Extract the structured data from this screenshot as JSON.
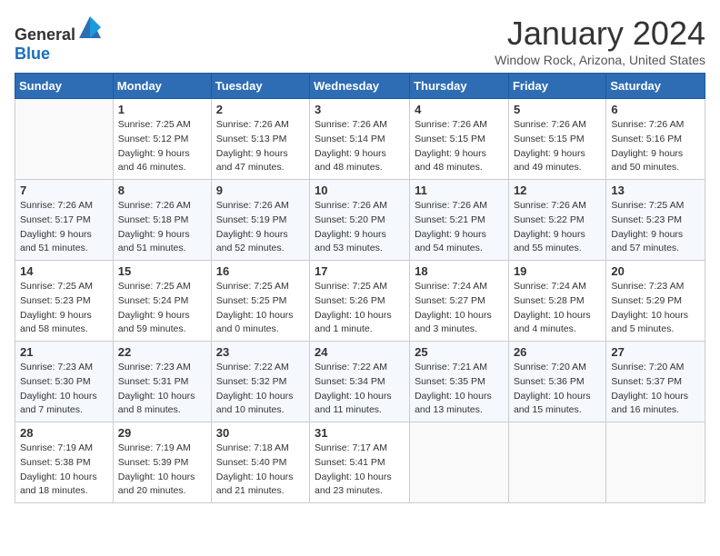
{
  "header": {
    "logo_general": "General",
    "logo_blue": "Blue",
    "month_title": "January 2024",
    "location": "Window Rock, Arizona, United States"
  },
  "days_of_week": [
    "Sunday",
    "Monday",
    "Tuesday",
    "Wednesday",
    "Thursday",
    "Friday",
    "Saturday"
  ],
  "weeks": [
    [
      {
        "day": "",
        "sunrise": "",
        "sunset": "",
        "daylight": ""
      },
      {
        "day": "1",
        "sunrise": "Sunrise: 7:25 AM",
        "sunset": "Sunset: 5:12 PM",
        "daylight": "Daylight: 9 hours and 46 minutes."
      },
      {
        "day": "2",
        "sunrise": "Sunrise: 7:26 AM",
        "sunset": "Sunset: 5:13 PM",
        "daylight": "Daylight: 9 hours and 47 minutes."
      },
      {
        "day": "3",
        "sunrise": "Sunrise: 7:26 AM",
        "sunset": "Sunset: 5:14 PM",
        "daylight": "Daylight: 9 hours and 48 minutes."
      },
      {
        "day": "4",
        "sunrise": "Sunrise: 7:26 AM",
        "sunset": "Sunset: 5:15 PM",
        "daylight": "Daylight: 9 hours and 48 minutes."
      },
      {
        "day": "5",
        "sunrise": "Sunrise: 7:26 AM",
        "sunset": "Sunset: 5:15 PM",
        "daylight": "Daylight: 9 hours and 49 minutes."
      },
      {
        "day": "6",
        "sunrise": "Sunrise: 7:26 AM",
        "sunset": "Sunset: 5:16 PM",
        "daylight": "Daylight: 9 hours and 50 minutes."
      }
    ],
    [
      {
        "day": "7",
        "sunrise": "Sunrise: 7:26 AM",
        "sunset": "Sunset: 5:17 PM",
        "daylight": "Daylight: 9 hours and 51 minutes."
      },
      {
        "day": "8",
        "sunrise": "Sunrise: 7:26 AM",
        "sunset": "Sunset: 5:18 PM",
        "daylight": "Daylight: 9 hours and 51 minutes."
      },
      {
        "day": "9",
        "sunrise": "Sunrise: 7:26 AM",
        "sunset": "Sunset: 5:19 PM",
        "daylight": "Daylight: 9 hours and 52 minutes."
      },
      {
        "day": "10",
        "sunrise": "Sunrise: 7:26 AM",
        "sunset": "Sunset: 5:20 PM",
        "daylight": "Daylight: 9 hours and 53 minutes."
      },
      {
        "day": "11",
        "sunrise": "Sunrise: 7:26 AM",
        "sunset": "Sunset: 5:21 PM",
        "daylight": "Daylight: 9 hours and 54 minutes."
      },
      {
        "day": "12",
        "sunrise": "Sunrise: 7:26 AM",
        "sunset": "Sunset: 5:22 PM",
        "daylight": "Daylight: 9 hours and 55 minutes."
      },
      {
        "day": "13",
        "sunrise": "Sunrise: 7:25 AM",
        "sunset": "Sunset: 5:23 PM",
        "daylight": "Daylight: 9 hours and 57 minutes."
      }
    ],
    [
      {
        "day": "14",
        "sunrise": "Sunrise: 7:25 AM",
        "sunset": "Sunset: 5:23 PM",
        "daylight": "Daylight: 9 hours and 58 minutes."
      },
      {
        "day": "15",
        "sunrise": "Sunrise: 7:25 AM",
        "sunset": "Sunset: 5:24 PM",
        "daylight": "Daylight: 9 hours and 59 minutes."
      },
      {
        "day": "16",
        "sunrise": "Sunrise: 7:25 AM",
        "sunset": "Sunset: 5:25 PM",
        "daylight": "Daylight: 10 hours and 0 minutes."
      },
      {
        "day": "17",
        "sunrise": "Sunrise: 7:25 AM",
        "sunset": "Sunset: 5:26 PM",
        "daylight": "Daylight: 10 hours and 1 minute."
      },
      {
        "day": "18",
        "sunrise": "Sunrise: 7:24 AM",
        "sunset": "Sunset: 5:27 PM",
        "daylight": "Daylight: 10 hours and 3 minutes."
      },
      {
        "day": "19",
        "sunrise": "Sunrise: 7:24 AM",
        "sunset": "Sunset: 5:28 PM",
        "daylight": "Daylight: 10 hours and 4 minutes."
      },
      {
        "day": "20",
        "sunrise": "Sunrise: 7:23 AM",
        "sunset": "Sunset: 5:29 PM",
        "daylight": "Daylight: 10 hours and 5 minutes."
      }
    ],
    [
      {
        "day": "21",
        "sunrise": "Sunrise: 7:23 AM",
        "sunset": "Sunset: 5:30 PM",
        "daylight": "Daylight: 10 hours and 7 minutes."
      },
      {
        "day": "22",
        "sunrise": "Sunrise: 7:23 AM",
        "sunset": "Sunset: 5:31 PM",
        "daylight": "Daylight: 10 hours and 8 minutes."
      },
      {
        "day": "23",
        "sunrise": "Sunrise: 7:22 AM",
        "sunset": "Sunset: 5:32 PM",
        "daylight": "Daylight: 10 hours and 10 minutes."
      },
      {
        "day": "24",
        "sunrise": "Sunrise: 7:22 AM",
        "sunset": "Sunset: 5:34 PM",
        "daylight": "Daylight: 10 hours and 11 minutes."
      },
      {
        "day": "25",
        "sunrise": "Sunrise: 7:21 AM",
        "sunset": "Sunset: 5:35 PM",
        "daylight": "Daylight: 10 hours and 13 minutes."
      },
      {
        "day": "26",
        "sunrise": "Sunrise: 7:20 AM",
        "sunset": "Sunset: 5:36 PM",
        "daylight": "Daylight: 10 hours and 15 minutes."
      },
      {
        "day": "27",
        "sunrise": "Sunrise: 7:20 AM",
        "sunset": "Sunset: 5:37 PM",
        "daylight": "Daylight: 10 hours and 16 minutes."
      }
    ],
    [
      {
        "day": "28",
        "sunrise": "Sunrise: 7:19 AM",
        "sunset": "Sunset: 5:38 PM",
        "daylight": "Daylight: 10 hours and 18 minutes."
      },
      {
        "day": "29",
        "sunrise": "Sunrise: 7:19 AM",
        "sunset": "Sunset: 5:39 PM",
        "daylight": "Daylight: 10 hours and 20 minutes."
      },
      {
        "day": "30",
        "sunrise": "Sunrise: 7:18 AM",
        "sunset": "Sunset: 5:40 PM",
        "daylight": "Daylight: 10 hours and 21 minutes."
      },
      {
        "day": "31",
        "sunrise": "Sunrise: 7:17 AM",
        "sunset": "Sunset: 5:41 PM",
        "daylight": "Daylight: 10 hours and 23 minutes."
      },
      {
        "day": "",
        "sunrise": "",
        "sunset": "",
        "daylight": ""
      },
      {
        "day": "",
        "sunrise": "",
        "sunset": "",
        "daylight": ""
      },
      {
        "day": "",
        "sunrise": "",
        "sunset": "",
        "daylight": ""
      }
    ]
  ]
}
